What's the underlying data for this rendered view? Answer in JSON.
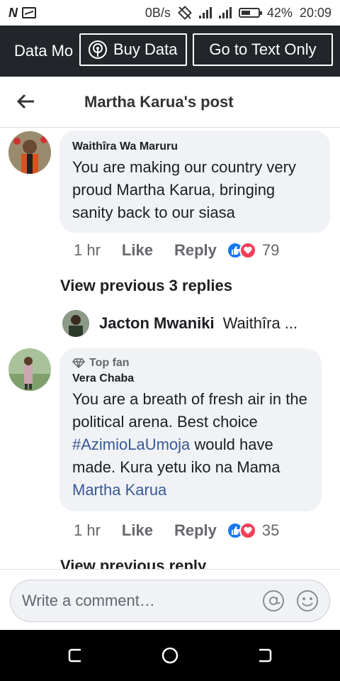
{
  "status_bar": {
    "left_badge": "N",
    "data_rate": "0B/s",
    "battery": "42%",
    "time": "20:09"
  },
  "data_banner": {
    "mode_label": "Data Mo",
    "buy_label": "Buy Data",
    "text_only_label": "Go to Text Only"
  },
  "header": {
    "title": "Martha Karua's post"
  },
  "comments": [
    {
      "author": "Waithîra Wa Maruru",
      "text": "You are making our country very proud Martha Karua, bringing sanity back to our siasa",
      "time": "1 hr",
      "like": "Like",
      "reply": "Reply",
      "reaction_count": "79"
    },
    {
      "badge": "Top fan",
      "author": "Vera Chaba",
      "text_part1": "You are a breath of fresh air in the political arena. Best choice ",
      "hashtag": "#AzimioLaUmoja",
      "text_part2": " would have made. Kura yetu iko na Mama ",
      "mention": "Martha Karua",
      "time": "1 hr",
      "like": "Like",
      "reply": "Reply",
      "reaction_count": "35"
    }
  ],
  "view_previous_replies": "View previous 3 replies",
  "reply_preview": {
    "name": "Jacton Mwaniki",
    "text": "Waithîra ..."
  },
  "view_previous_reply": "View previous reply",
  "composer": {
    "placeholder": "Write a comment…"
  },
  "colors": {
    "link": "#385898",
    "like_blue": "#1877f2",
    "love_red": "#f33e58",
    "banner_bg": "#22252a"
  }
}
